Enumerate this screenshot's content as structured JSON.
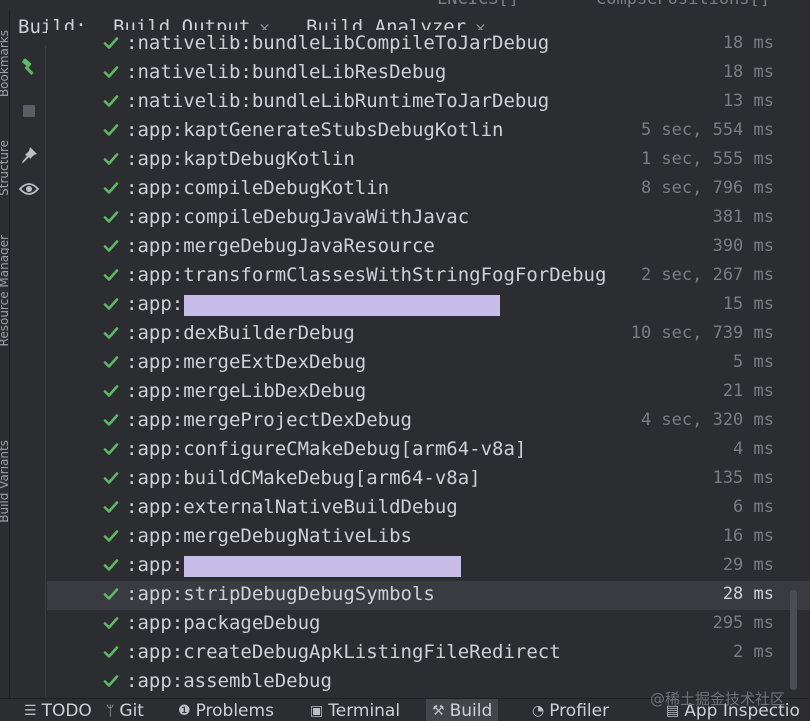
{
  "top_strip": {
    "fragments": [
      "LNCICS[]",
      "CompsePositions[]"
    ]
  },
  "left_strip": {
    "labels": [
      "Bookmarks",
      "Structure",
      "Resource Manager",
      "Build Variants"
    ]
  },
  "build_panel": {
    "title": "Build:",
    "tabs": [
      {
        "label": "Build Output",
        "close": "×",
        "active": true
      },
      {
        "label": "Build Analyzer",
        "close": "×",
        "active": false
      }
    ],
    "toolbar": [
      "hammer-icon",
      "stop-icon",
      "pin-icon",
      "eye-icon"
    ]
  },
  "tasks": [
    {
      "name": ":nativelib:bundleLibCompileToJarDebug",
      "time": "18 ms"
    },
    {
      "name": ":nativelib:bundleLibResDebug",
      "time": "18 ms"
    },
    {
      "name": ":nativelib:bundleLibRuntimeToJarDebug",
      "time": "13 ms"
    },
    {
      "name": ":app:kaptGenerateStubsDebugKotlin",
      "time": "5 sec, 554 ms"
    },
    {
      "name": ":app:kaptDebugKotlin",
      "time": "1 sec, 555 ms"
    },
    {
      "name": ":app:compileDebugKotlin",
      "time": "8 sec, 796 ms"
    },
    {
      "name": ":app:compileDebugJavaWithJavac",
      "time": "381 ms"
    },
    {
      "name": ":app:mergeDebugJavaResource",
      "time": "390 ms"
    },
    {
      "name": ":app:transformClassesWithStringFogForDebug",
      "time": "2 sec, 267 ms"
    },
    {
      "name": ":app:",
      "time": "15 ms",
      "redacted": true
    },
    {
      "name": ":app:dexBuilderDebug",
      "time": "10 sec, 739 ms"
    },
    {
      "name": ":app:mergeExtDexDebug",
      "time": "5 ms"
    },
    {
      "name": ":app:mergeLibDexDebug",
      "time": "21 ms"
    },
    {
      "name": ":app:mergeProjectDexDebug",
      "time": "4 sec, 320 ms"
    },
    {
      "name": ":app:configureCMakeDebug[arm64-v8a]",
      "time": "4 ms"
    },
    {
      "name": ":app:buildCMakeDebug[arm64-v8a]",
      "time": "135 ms"
    },
    {
      "name": ":app:externalNativeBuildDebug",
      "time": "6 ms"
    },
    {
      "name": ":app:mergeDebugNativeLibs",
      "time": "16 ms"
    },
    {
      "name": ":app:",
      "time": "29 ms",
      "redacted": true
    },
    {
      "name": ":app:stripDebugDebugSymbols",
      "time": "28 ms",
      "selected": true
    },
    {
      "name": ":app:packageDebug",
      "time": "295 ms"
    },
    {
      "name": ":app:createDebugApkListingFileRedirect",
      "time": "2 ms"
    },
    {
      "name": ":app:assembleDebug",
      "time": ""
    }
  ],
  "bottom_bar": [
    {
      "label": "TODO",
      "icon": "list-icon"
    },
    {
      "label": "Git",
      "icon": "git-branch-icon"
    },
    {
      "label": "Problems",
      "icon": "problems-icon"
    },
    {
      "label": "Terminal",
      "icon": "terminal-icon"
    },
    {
      "label": "Build",
      "icon": "hammer-icon",
      "active": true
    },
    {
      "label": "Profiler",
      "icon": "profiler-icon"
    },
    {
      "label": "App Inspectio",
      "icon": "app-inspection-icon"
    }
  ],
  "watermark": "@稀土掘金技术社区",
  "colors": {
    "background": "#2b2d30",
    "check": "#5fb865",
    "accent": "#3d74d8",
    "redaction": "#c8bde8",
    "selection": "#393b40"
  }
}
